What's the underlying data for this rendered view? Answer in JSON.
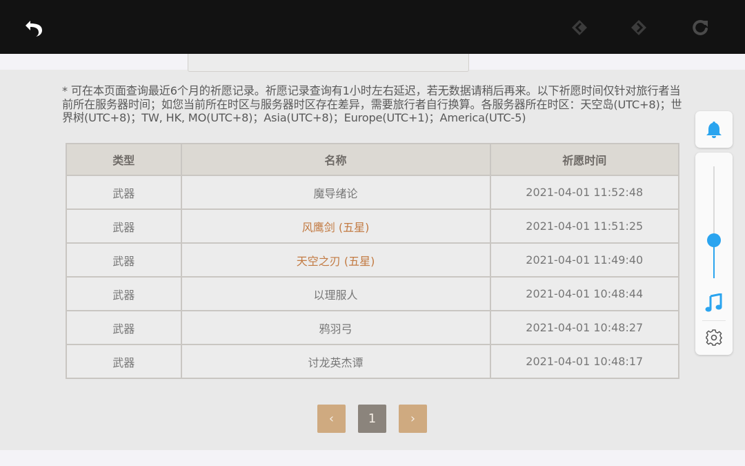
{
  "browser": {
    "back_icon": "back-arrow-icon",
    "prev_icon": "diamond-left-icon",
    "next_icon": "diamond-right-icon",
    "reload_icon": "reload-icon"
  },
  "notice": "* 可在本页面查询最近6个月的祈愿记录。祈愿记录查询有1小时左右延迟，若无数据请稍后再来。以下祈愿时间仅针对旅行者当前所在服务器时间；如您当前所在时区与服务器时区存在差异，需要旅行者自行换算。各服务器所在时区：天空岛(UTC+8)；世界树(UTC+8)；TW, HK, MO(UTC+8)；Asia(UTC+8)；Europe(UTC+1)；America(UTC-5)",
  "table": {
    "headers": [
      "类型",
      "名称",
      "祈愿时间"
    ],
    "rows": [
      {
        "type": "武器",
        "name": "魔导绪论",
        "time": "2021-04-01 11:52:48"
      },
      {
        "type": "武器",
        "name": "风鹰剑 (五星)",
        "time": "2021-04-01 11:51:25"
      },
      {
        "type": "武器",
        "name": "天空之刃 (五星)",
        "time": "2021-04-01 11:49:40"
      },
      {
        "type": "武器",
        "name": "以理服人",
        "time": "2021-04-01 10:48:44"
      },
      {
        "type": "武器",
        "name": "鸦羽弓",
        "time": "2021-04-01 10:48:27"
      },
      {
        "type": "武器",
        "name": "讨龙英杰谭",
        "time": "2021-04-01 10:48:17"
      }
    ]
  },
  "pagination": {
    "prev": "‹",
    "current": "1",
    "next": "›"
  },
  "side_panel": {
    "volume_level": 0.34,
    "bell_icon": "bell-icon",
    "music_icon": "music-note-icon",
    "settings_icon": "gear-icon"
  },
  "colors": {
    "five_star": "#c27a42",
    "pager_arrow": "#cfaa80",
    "pager_current": "#8b847c",
    "accent": "#2aa4ef"
  }
}
